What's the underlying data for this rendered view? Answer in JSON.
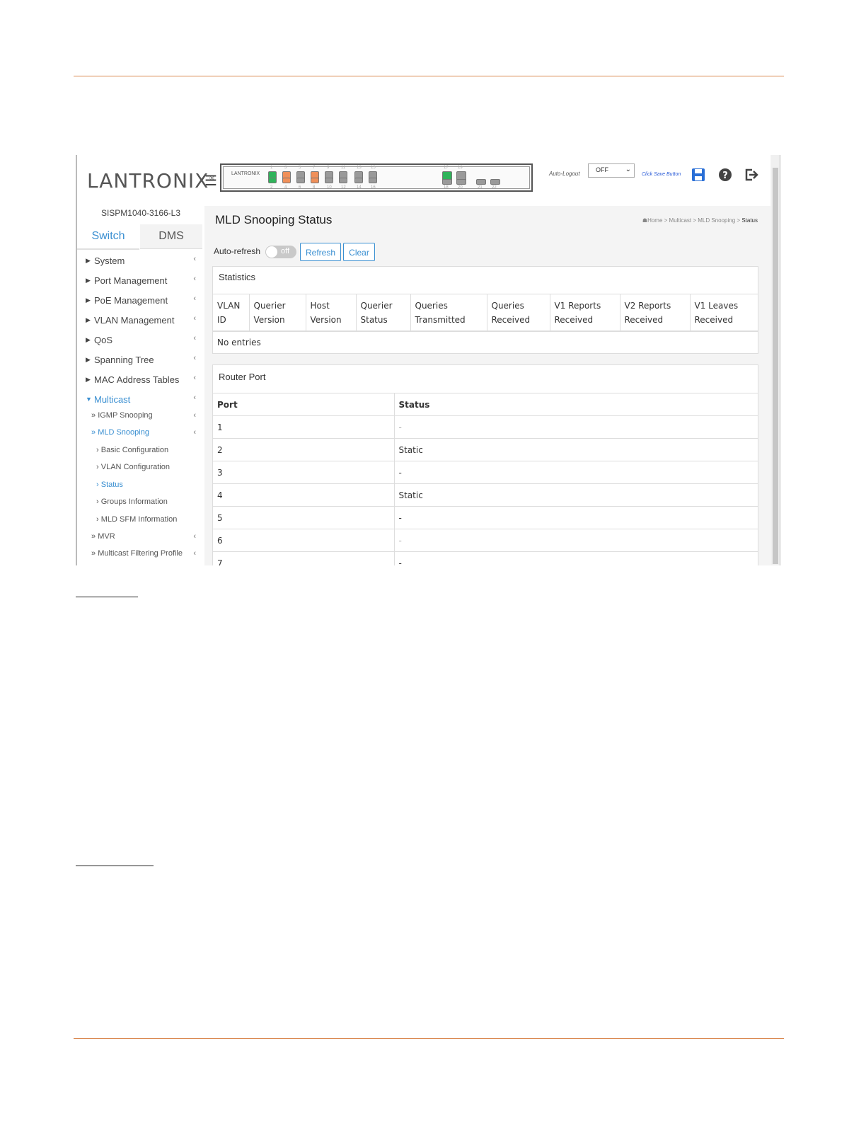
{
  "brand": {
    "logo_text": "LANTRONIX",
    "logo_x": "X",
    "trademark": "®"
  },
  "topbar": {
    "auto_logout_label": "Auto-Logout",
    "auto_logout_value": "OFF",
    "click_save": "Click Save Button",
    "icons": [
      "menu-icon",
      "save-icon",
      "help-icon",
      "logout-icon"
    ]
  },
  "switch_panel": {
    "logo": "LANTRONIX",
    "top_labels": [
      "1",
      "3",
      "5",
      "7",
      "9",
      "11",
      "13",
      "15"
    ],
    "bottom_labels": [
      "2",
      "4",
      "6",
      "8",
      "10",
      "12",
      "14",
      "16"
    ],
    "sfp_top": [
      "17",
      "19"
    ],
    "sfp_bottom": [
      "18",
      "20",
      "21",
      "22"
    ]
  },
  "sidebar": {
    "device_name": "SISPM1040-3166-L3",
    "tabs": [
      "Switch",
      "DMS"
    ],
    "items": [
      {
        "label": "System"
      },
      {
        "label": "Port Management"
      },
      {
        "label": "PoE Management"
      },
      {
        "label": "VLAN Management"
      },
      {
        "label": "QoS"
      },
      {
        "label": "Spanning Tree"
      },
      {
        "label": "MAC Address Tables"
      },
      {
        "label": "Multicast"
      }
    ],
    "sub_items": [
      {
        "label": "IGMP Snooping"
      },
      {
        "label": "MLD Snooping"
      },
      {
        "label": "Basic Configuration"
      },
      {
        "label": "VLAN Configuration"
      },
      {
        "label": "Status"
      },
      {
        "label": "Groups Information"
      },
      {
        "label": "MLD SFM Information"
      },
      {
        "label": "MVR"
      },
      {
        "label": "Multicast Filtering Profile"
      }
    ]
  },
  "main": {
    "title": "MLD Snooping Status",
    "breadcrumb": [
      "Home",
      "Multicast",
      "MLD Snooping",
      "Status"
    ],
    "breadcrumb_sep": ">",
    "auto_refresh_label": "Auto-refresh",
    "toggle_state": "off",
    "refresh_label": "Refresh",
    "clear_label": "Clear",
    "statistics": {
      "heading": "Statistics",
      "columns": [
        [
          "VLAN",
          "ID"
        ],
        [
          "Querier",
          "Version"
        ],
        [
          "Host",
          "Version"
        ],
        [
          "Querier",
          "Status"
        ],
        [
          "Queries",
          "Transmitted"
        ],
        [
          "Queries",
          "Received"
        ],
        [
          "V1 Reports",
          "Received"
        ],
        [
          "V2 Reports",
          "Received"
        ],
        [
          "V1 Leaves",
          "Received"
        ]
      ],
      "empty_text": "No entries"
    },
    "router_port": {
      "heading": "Router Port",
      "columns": [
        "Port",
        "Status"
      ],
      "rows": [
        [
          "1",
          "-"
        ],
        [
          "2",
          "Static"
        ],
        [
          "3",
          "-"
        ],
        [
          "4",
          "Static"
        ],
        [
          "5",
          "-"
        ],
        [
          "6",
          "-"
        ],
        [
          "7",
          "-"
        ]
      ]
    }
  },
  "colors": {
    "accent": "#3a8fd1",
    "brand_orange": "#e0632a",
    "rule": "#d9874f",
    "port_green": "#2fb35a",
    "port_orange": "#f0905a",
    "port_gray": "#9a9a9a"
  }
}
